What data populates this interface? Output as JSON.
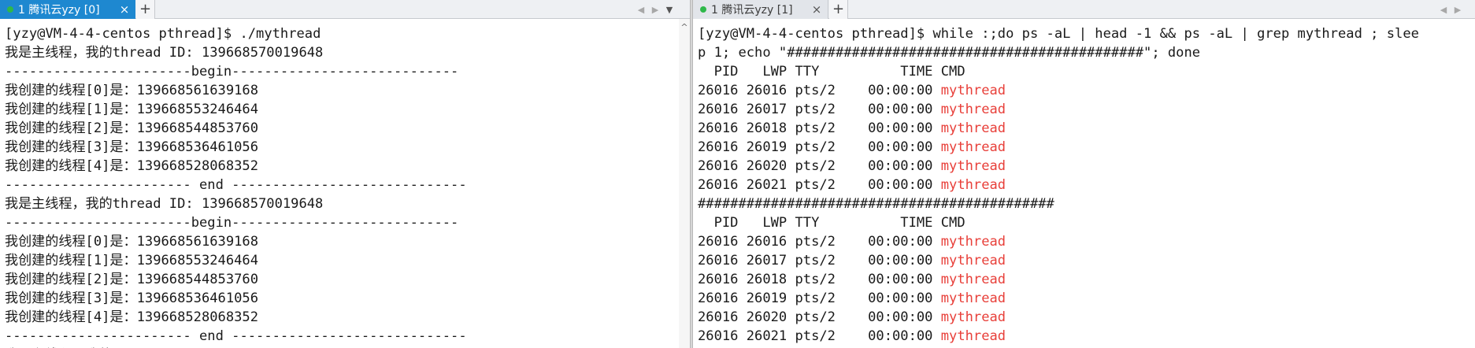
{
  "left": {
    "tab_label": "1 腾讯云yzy [0]",
    "close": "×",
    "add": "+",
    "nav_prev": "◀",
    "nav_next": "▶",
    "nav_menu": "▼",
    "scroll_up": "^",
    "lines": [
      "[yzy@VM-4-4-centos pthread]$ ./mythread",
      "我是主线程，我的thread ID: 139668570019648",
      "-----------------------begin----------------------------",
      "我创建的线程[0]是：139668561639168",
      "我创建的线程[1]是：139668553246464",
      "我创建的线程[2]是：139668544853760",
      "我创建的线程[3]是：139668536461056",
      "我创建的线程[4]是：139668528068352",
      "----------------------- end -----------------------------",
      "我是主线程，我的thread ID: 139668570019648",
      "-----------------------begin----------------------------",
      "我创建的线程[0]是：139668561639168",
      "我创建的线程[1]是：139668553246464",
      "我创建的线程[2]是：139668544853760",
      "我创建的线程[3]是：139668536461056",
      "我创建的线程[4]是：139668528068352",
      "----------------------- end -----------------------------",
      "我是主线程，我的"
    ]
  },
  "right": {
    "tab_label": "1 腾讯云yzy [1]",
    "close": "×",
    "add": "+",
    "nav_prev": "◀",
    "nav_next": "▶",
    "command_line_1": "[yzy@VM-4-4-centos pthread]$ while :;do ps -aL | head -1 && ps -aL | grep mythread ; slee",
    "command_line_2": "p 1; echo \"############################################\"; done",
    "header": "  PID   LWP TTY          TIME CMD",
    "separator": "############################################",
    "process_name": "mythread",
    "blocks": [
      [
        "26016 26016 pts/2    00:00:00 ",
        "26016 26017 pts/2    00:00:00 ",
        "26016 26018 pts/2    00:00:00 ",
        "26016 26019 pts/2    00:00:00 ",
        "26016 26020 pts/2    00:00:00 ",
        "26016 26021 pts/2    00:00:00 "
      ],
      [
        "26016 26016 pts/2    00:00:00 ",
        "26016 26017 pts/2    00:00:00 ",
        "26016 26018 pts/2    00:00:00 ",
        "26016 26019 pts/2    00:00:00 ",
        "26016 26020 pts/2    00:00:00 ",
        "26016 26021 pts/2    00:00:00 "
      ]
    ]
  },
  "colors": {
    "tab_active": "#1e88d0",
    "status_dot": "#2fb84a",
    "process_highlight": "#e8403a"
  }
}
